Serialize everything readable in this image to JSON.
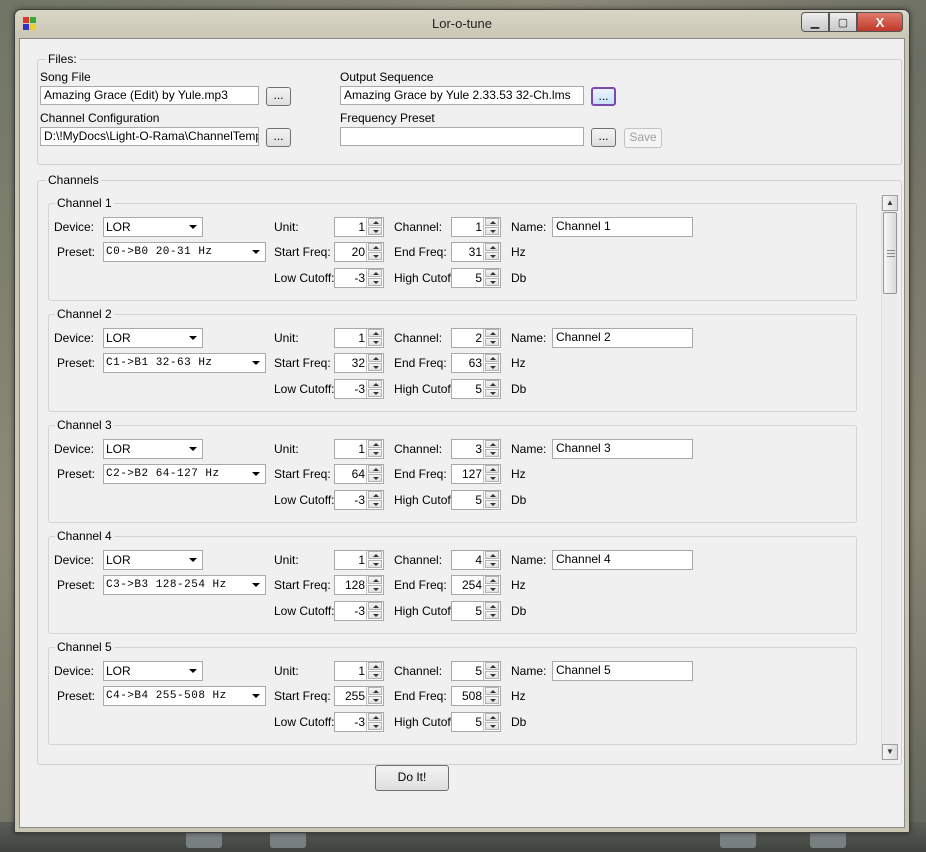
{
  "window": {
    "title": "Lor-o-tune",
    "min_glyph": "▁",
    "max_glyph": "▢",
    "close_glyph": "X"
  },
  "files": {
    "group_label": "Files:",
    "song_file": {
      "label": "Song File",
      "value": "Amazing Grace (Edit) by Yule.mp3",
      "browse": "..."
    },
    "channel_config": {
      "label": "Channel Configuration",
      "value": "D:\\!MyDocs\\Light-O-Rama\\ChannelTemplate",
      "browse": "..."
    },
    "output_sequence": {
      "label": "Output Sequence",
      "value": "Amazing Grace by Yule 2.33.53 32-Ch.lms",
      "browse": "..."
    },
    "frequency_preset": {
      "label": "Frequency Preset",
      "value": "",
      "browse": "...",
      "save": "Save"
    }
  },
  "channels_label": "Channels",
  "field_labels": {
    "device": "Device:",
    "preset": "Preset:",
    "unit": "Unit:",
    "start_freq": "Start Freq:",
    "low_cutoff": "Low Cutoff:",
    "channel": "Channel:",
    "end_freq": "End Freq:",
    "high_cutoff": "High Cutoff:",
    "name": "Name:",
    "hz": "Hz",
    "db": "Db"
  },
  "channels": [
    {
      "title": "Channel 1",
      "device": "LOR",
      "preset": "C0->B0  20-31 Hz",
      "unit": "1",
      "start_freq": "20",
      "low_cutoff": "-3",
      "channel": "1",
      "end_freq": "31",
      "high_cutoff": "5",
      "name": "Channel 1"
    },
    {
      "title": "Channel 2",
      "device": "LOR",
      "preset": "C1->B1  32-63 Hz",
      "unit": "1",
      "start_freq": "32",
      "low_cutoff": "-3",
      "channel": "2",
      "end_freq": "63",
      "high_cutoff": "5",
      "name": "Channel 2"
    },
    {
      "title": "Channel 3",
      "device": "LOR",
      "preset": "C2->B2  64-127 Hz",
      "unit": "1",
      "start_freq": "64",
      "low_cutoff": "-3",
      "channel": "3",
      "end_freq": "127",
      "high_cutoff": "5",
      "name": "Channel 3"
    },
    {
      "title": "Channel 4",
      "device": "LOR",
      "preset": "C3->B3  128-254 Hz",
      "unit": "1",
      "start_freq": "128",
      "low_cutoff": "-3",
      "channel": "4",
      "end_freq": "254",
      "high_cutoff": "5",
      "name": "Channel 4"
    },
    {
      "title": "Channel 5",
      "device": "LOR",
      "preset": "C4->B4  255-508 Hz",
      "unit": "1",
      "start_freq": "255",
      "low_cutoff": "-3",
      "channel": "5",
      "end_freq": "508",
      "high_cutoff": "5",
      "name": "Channel 5"
    }
  ],
  "do_it_button": "Do It!"
}
